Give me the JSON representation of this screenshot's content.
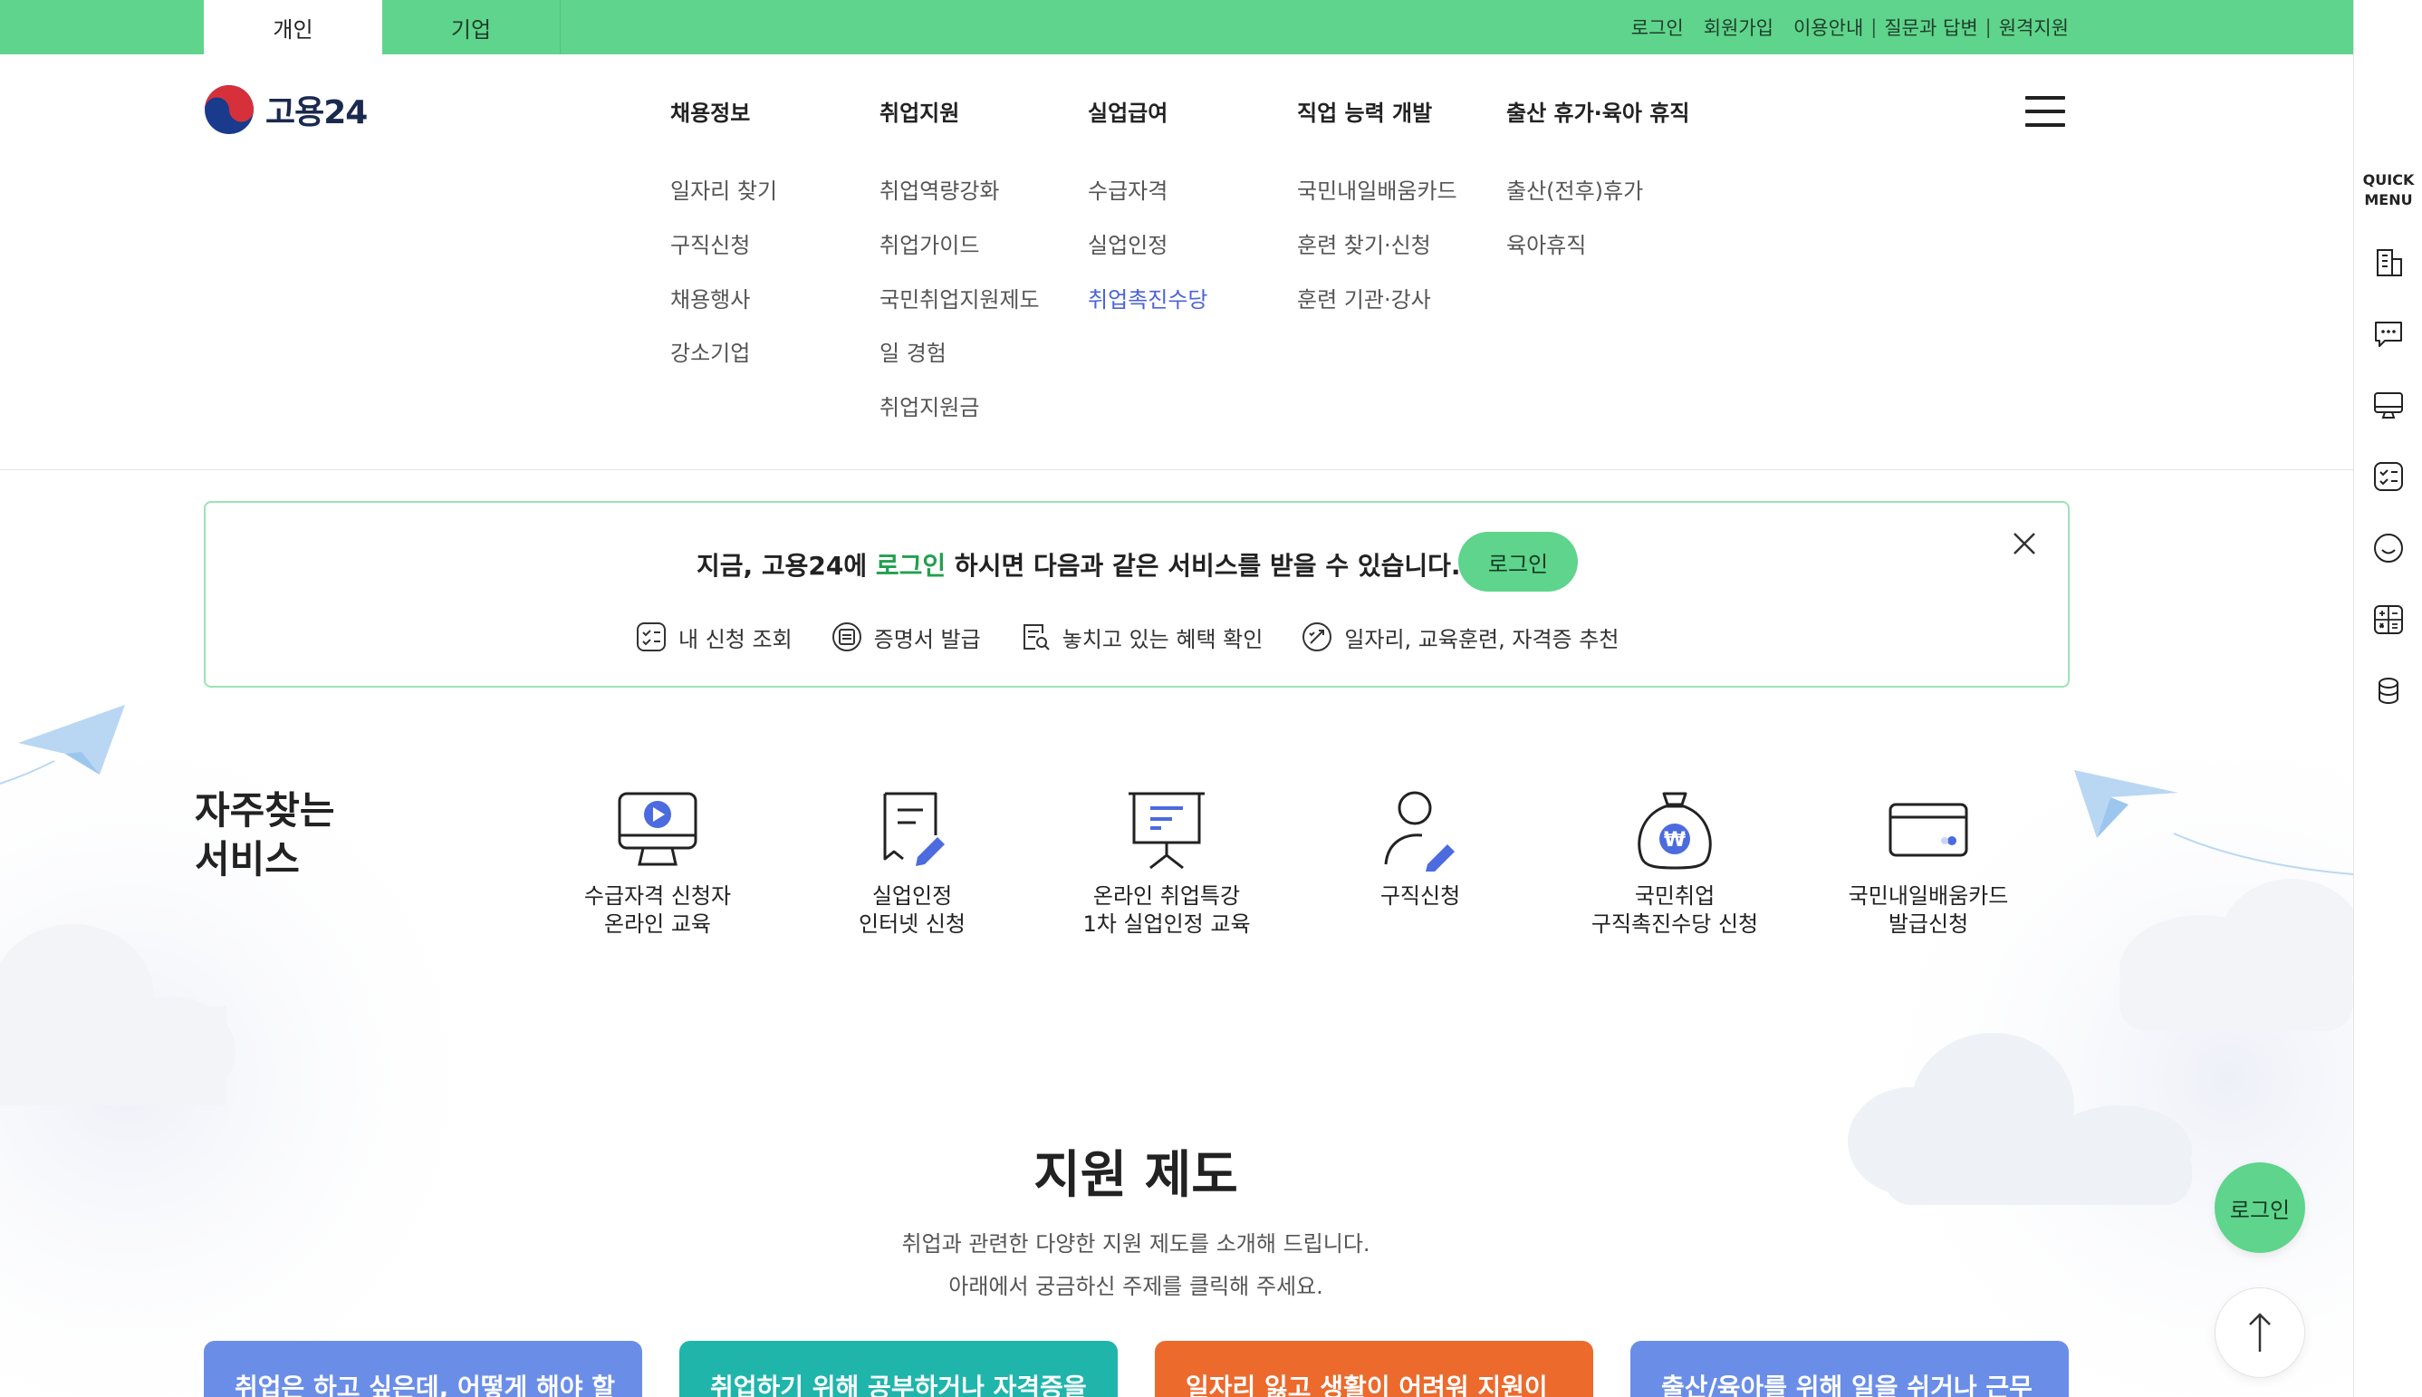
{
  "topbar": {
    "tabs": [
      "개인",
      "기업"
    ],
    "util": [
      "로그인",
      "회원가입"
    ],
    "util_group": [
      "이용안내",
      "질문과 답변",
      "원격지원"
    ]
  },
  "logo": {
    "text": "고용24"
  },
  "nav": [
    {
      "label": "채용정보",
      "items": [
        "일자리 찾기",
        "구직신청",
        "채용행사",
        "강소기업"
      ]
    },
    {
      "label": "취업지원",
      "items": [
        "취업역량강화",
        "취업가이드",
        "국민취업지원제도",
        "일 경험",
        "취업지원금"
      ]
    },
    {
      "label": "실업급여",
      "items": [
        "수급자격",
        "실업인정",
        "취업촉진수당"
      ]
    },
    {
      "label": "직업 능력 개발",
      "items": [
        "국민내일배움카드",
        "훈련 찾기·신청",
        "훈련 기관·강사"
      ]
    },
    {
      "label": "출산 휴가·육아 휴직",
      "items": [
        "출산(전후)휴가",
        "육아휴직"
      ]
    }
  ],
  "banner": {
    "msg_pre": "지금, 고용24에 ",
    "msg_link": "로그인",
    "msg_post": " 하시면 다음과 같은 서비스를 받을 수 있습니다.",
    "login_label": "로그인",
    "features": [
      "내 신청 조회",
      "증명서 발급",
      "놓치고 있는 혜택 확인",
      "일자리, 교육훈련, 자격증 추천"
    ]
  },
  "frequent": {
    "title_line1": "자주찾는",
    "title_line2": "서비스",
    "items": [
      {
        "l1": "수급자격 신청자",
        "l2": "온라인 교육",
        "icon": "monitor-play-icon"
      },
      {
        "l1": "실업인정",
        "l2": "인터넷 신청",
        "icon": "document-edit-icon"
      },
      {
        "l1": "온라인 취업특강",
        "l2": "1차 실업인정 교육",
        "icon": "presentation-board-icon"
      },
      {
        "l1": "구직신청",
        "l2": "",
        "icon": "person-edit-icon"
      },
      {
        "l1": "국민취업",
        "l2": "구직촉진수당 신청",
        "icon": "money-bag-icon"
      },
      {
        "l1": "국민내일배움카드",
        "l2": "발급신청",
        "icon": "card-icon"
      }
    ]
  },
  "support": {
    "title": "지원 제도",
    "desc1": "취업과 관련한 다양한 지원 제도를 소개해 드립니다.",
    "desc2": "아래에서 궁금하신 주제를 클릭해 주세요.",
    "cards": [
      {
        "label": "취업은 하고 싶은데, 어떻게 해야 할",
        "color": "#6a8ee8"
      },
      {
        "label": "취업하기 위해 공부하거나 자격증을",
        "color": "#1fb5ab"
      },
      {
        "label": "일자리 잃고 생활이 어려워 지원이",
        "color": "#ec6a2c"
      },
      {
        "label": "출산/육아를 위해 일을 쉬거나 근무",
        "color": "#6a8ee8"
      }
    ]
  },
  "fab": {
    "login_label": "로그인"
  },
  "quick": {
    "title_line1": "QUICK",
    "title_line2": "MENU"
  },
  "colors": {
    "brand_green": "#5fd48c",
    "link_blue": "#4a63d8",
    "accent_blue": "#4b6bde"
  }
}
